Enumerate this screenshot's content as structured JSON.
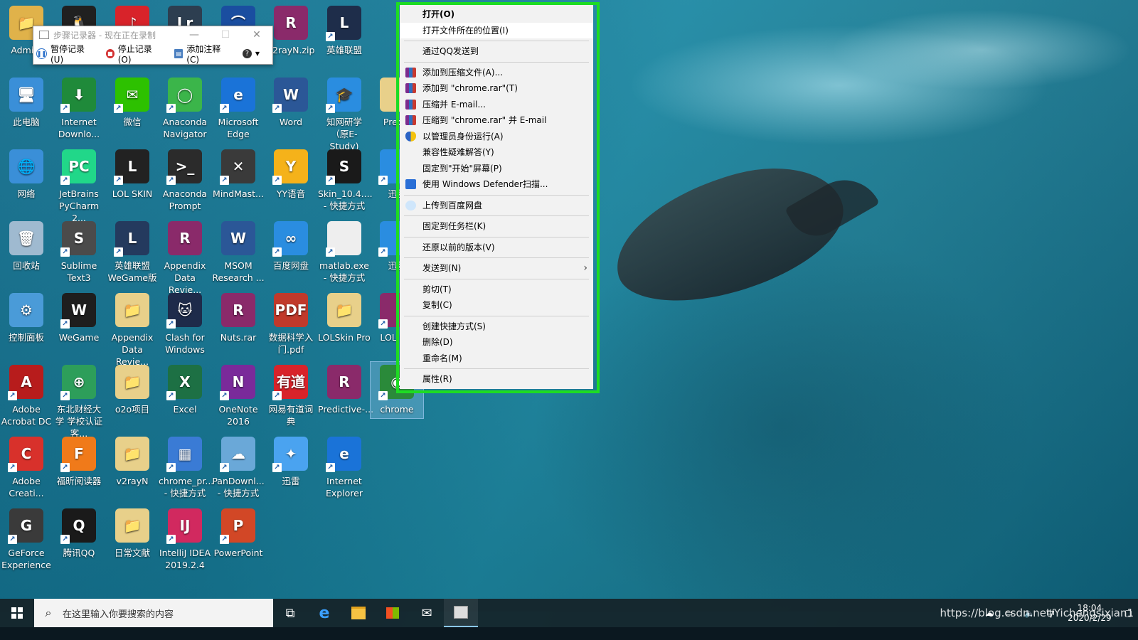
{
  "desktop": {
    "icons": [
      {
        "label": "Admini",
        "color": "#e0b24a",
        "glyph": "📁",
        "shortcut": false
      },
      {
        "label": "此电脑",
        "color": "#3a8fd8",
        "glyph": "🖥",
        "shortcut": false
      },
      {
        "label": "网络",
        "color": "#3a8fd8",
        "glyph": "🌐",
        "shortcut": false
      },
      {
        "label": "回收站",
        "color": "#9fbad0",
        "glyph": "🗑",
        "shortcut": false
      },
      {
        "label": "控制面板",
        "color": "#4a9bd8",
        "glyph": "⚙",
        "shortcut": false
      },
      {
        "label": "Adobe Acrobat DC",
        "color": "#b71c1c",
        "glyph": "A",
        "shortcut": true
      },
      {
        "label": "Adobe Creati...",
        "color": "#d8312b",
        "glyph": "C",
        "shortcut": true
      },
      {
        "label": "GeForce Experience",
        "color": "#3a3a3a",
        "glyph": "G",
        "shortcut": true
      },
      {
        "label": "",
        "color": "#202020",
        "glyph": "🐧",
        "shortcut": false
      },
      {
        "label": "Internet Downlo...",
        "color": "#1f8a3a",
        "glyph": "⬇",
        "shortcut": true
      },
      {
        "label": "JetBrains PyCharm 2...",
        "color": "#21d789",
        "glyph": "PC",
        "shortcut": true
      },
      {
        "label": "Sublime Text3",
        "color": "#4b4b4b",
        "glyph": "S",
        "shortcut": true
      },
      {
        "label": "WeGame",
        "color": "#1e1e1e",
        "glyph": "W",
        "shortcut": true
      },
      {
        "label": "东北财经大学 学校认证客...",
        "color": "#2d9e5a",
        "glyph": "⊕",
        "shortcut": true
      },
      {
        "label": "福昕阅读器",
        "color": "#f07a1a",
        "glyph": "F",
        "shortcut": true
      },
      {
        "label": "腾讯QQ",
        "color": "#1a1a1a",
        "glyph": "Q",
        "shortcut": true
      },
      {
        "label": "",
        "color": "#d8232a",
        "glyph": "♪",
        "shortcut": false
      },
      {
        "label": "微信",
        "color": "#2dc100",
        "glyph": "✉",
        "shortcut": true
      },
      {
        "label": "LOL SKIN",
        "color": "#222222",
        "glyph": "L",
        "shortcut": true
      },
      {
        "label": "英雄联盟 WeGame版",
        "color": "#243a5e",
        "glyph": "L",
        "shortcut": true
      },
      {
        "label": "Appendix Data Revie...",
        "color": "#e8d08a",
        "glyph": "📁",
        "shortcut": false
      },
      {
        "label": "o2o项目",
        "color": "#e8d08a",
        "glyph": "📁",
        "shortcut": false
      },
      {
        "label": "v2rayN",
        "color": "#e8d08a",
        "glyph": "📁",
        "shortcut": false
      },
      {
        "label": "日常文献",
        "color": "#e8d08a",
        "glyph": "📁",
        "shortcut": false
      },
      {
        "label": "",
        "color": "#2d3e50",
        "glyph": "Lr",
        "shortcut": false
      },
      {
        "label": "Anaconda Navigator",
        "color": "#3bb54a",
        "glyph": "◯",
        "shortcut": true
      },
      {
        "label": "Anaconda Prompt",
        "color": "#2b2b2b",
        "glyph": ">_",
        "shortcut": true
      },
      {
        "label": "Appendix Data Revie...",
        "color": "#8a2a6a",
        "glyph": "R",
        "shortcut": false
      },
      {
        "label": "Clash for Windows",
        "color": "#1e2b4a",
        "glyph": "🐱",
        "shortcut": true
      },
      {
        "label": "Excel",
        "color": "#1d7044",
        "glyph": "X",
        "shortcut": true
      },
      {
        "label": "chrome_pr... - 快捷方式",
        "color": "#3a7bd5",
        "glyph": "▦",
        "shortcut": true
      },
      {
        "label": "IntelliJ IDEA 2019.2.4",
        "color": "#d1295f",
        "glyph": "IJ",
        "shortcut": true
      },
      {
        "label": "",
        "color": "#1a4ea0",
        "glyph": "⌒",
        "shortcut": false
      },
      {
        "label": "Microsoft Edge",
        "color": "#1a73d8",
        "glyph": "e",
        "shortcut": true
      },
      {
        "label": "MindMast...",
        "color": "#3a3a3a",
        "glyph": "✕",
        "shortcut": true
      },
      {
        "label": "MSOM Research ...",
        "color": "#2b5797",
        "glyph": "W",
        "shortcut": false
      },
      {
        "label": "Nuts.rar",
        "color": "#8a2a6a",
        "glyph": "R",
        "shortcut": false
      },
      {
        "label": "OneNote 2016",
        "color": "#7a2a9a",
        "glyph": "N",
        "shortcut": true
      },
      {
        "label": "PanDownl... - 快捷方式",
        "color": "#6aa8d8",
        "glyph": "☁",
        "shortcut": true
      },
      {
        "label": "PowerPoint",
        "color": "#d24726",
        "glyph": "P",
        "shortcut": true
      },
      {
        "label": "v2rayN.zip",
        "color": "#8a2a6a",
        "glyph": "R",
        "shortcut": false
      },
      {
        "label": "Word",
        "color": "#2b5797",
        "glyph": "W",
        "shortcut": true
      },
      {
        "label": "YY语音",
        "color": "#f5b21a",
        "glyph": "Y",
        "shortcut": true
      },
      {
        "label": "百度网盘",
        "color": "#2a8de0",
        "glyph": "∞",
        "shortcut": true
      },
      {
        "label": "数据科学入门.pdf",
        "color": "#c0392b",
        "glyph": "PDF",
        "shortcut": false
      },
      {
        "label": "网易有道词典",
        "color": "#d8232a",
        "glyph": "有道",
        "shortcut": true
      },
      {
        "label": "迅雷",
        "color": "#4aa3f0",
        "glyph": "✦",
        "shortcut": true
      },
      {
        "label": "英雄联盟",
        "color": "#1e2d4a",
        "glyph": "L",
        "shortcut": true
      },
      {
        "label": "知网研学（原E-Study)",
        "color": "#2a8de0",
        "glyph": "🎓",
        "shortcut": true
      },
      {
        "label": "Skin_10.4.... - 快捷方式",
        "color": "#1a1a1a",
        "glyph": "S",
        "shortcut": true
      },
      {
        "label": "matlab.exe - 快捷方式",
        "color": "#eeeeee",
        "glyph": "",
        "shortcut": true
      },
      {
        "label": "LOLSkin Pro",
        "color": "#e8d08a",
        "glyph": "📁",
        "shortcut": false
      },
      {
        "label": "Predictive-...",
        "color": "#8a2a6a",
        "glyph": "R",
        "shortcut": false
      },
      {
        "label": "Internet Explorer",
        "color": "#1a73d8",
        "glyph": "e",
        "shortcut": true
      },
      {
        "label": "Predic",
        "color": "#e8d08a",
        "glyph": "",
        "shortcut": false
      },
      {
        "label": "迅雷",
        "color": "#2a8de0",
        "glyph": "",
        "shortcut": true
      },
      {
        "label": "迅雷",
        "color": "#2a8de0",
        "glyph": "",
        "shortcut": true
      },
      {
        "label": "LOL Pro",
        "color": "#8a2a6a",
        "glyph": "",
        "shortcut": true
      },
      {
        "label": "chrome",
        "color": "#2a8a3a",
        "glyph": "◉",
        "shortcut": true,
        "selected": true
      }
    ]
  },
  "steps_recorder": {
    "title": "步骤记录器 - 现在正在录制",
    "pause_label": "暂停记录(U)",
    "stop_label": "停止记录(O)",
    "comment_label": "添加注释(C)",
    "help_label": "?",
    "min": "—",
    "max": "☐",
    "close": "✕"
  },
  "context_menu": {
    "items": [
      {
        "label": "打开(O)",
        "bold": true
      },
      {
        "label": "打开文件所在的位置(I)",
        "hover": true
      },
      {
        "sep": true
      },
      {
        "label": "通过QQ发送到"
      },
      {
        "sep": true
      },
      {
        "label": "添加到压缩文件(A)...",
        "icon": "winrar"
      },
      {
        "label": "添加到 \"chrome.rar\"(T)",
        "icon": "winrar"
      },
      {
        "label": "压缩并 E-mail...",
        "icon": "winrar"
      },
      {
        "label": "压缩到 \"chrome.rar\" 并 E-mail",
        "icon": "winrar"
      },
      {
        "label": "以管理员身份运行(A)",
        "icon": "shield"
      },
      {
        "label": "兼容性疑难解答(Y)"
      },
      {
        "label": "固定到\"开始\"屏幕(P)"
      },
      {
        "label": "使用 Windows Defender扫描...",
        "icon": "defender"
      },
      {
        "sep": true
      },
      {
        "label": "上传到百度网盘",
        "icon": "baidu"
      },
      {
        "sep": true
      },
      {
        "label": "固定到任务栏(K)"
      },
      {
        "sep": true
      },
      {
        "label": "还原以前的版本(V)"
      },
      {
        "sep": true
      },
      {
        "label": "发送到(N)",
        "submenu": true
      },
      {
        "sep": true
      },
      {
        "label": "剪切(T)"
      },
      {
        "label": "复制(C)"
      },
      {
        "sep": true
      },
      {
        "label": "创建快捷方式(S)"
      },
      {
        "label": "删除(D)"
      },
      {
        "label": "重命名(M)"
      },
      {
        "sep": true
      },
      {
        "label": "属性(R)"
      }
    ],
    "highlight_color": "#1ddc22"
  },
  "taskbar": {
    "search_placeholder": "在这里输入你要搜索的内容",
    "time": "18:04",
    "date": "2020/2/29",
    "ime": "中",
    "watermark": "https://blog.csdn.net/Yichengsixian1"
  }
}
